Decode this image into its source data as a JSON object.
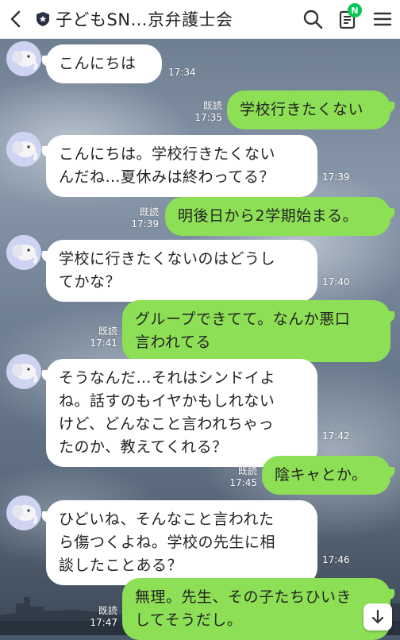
{
  "header": {
    "title": "子どもSN…京弁護士会",
    "notification_badge": "N",
    "icons": [
      "back-chevron-icon",
      "shield-star-icon",
      "search-icon",
      "notes-icon",
      "menu-icon"
    ]
  },
  "messages": [
    {
      "side": "left",
      "lines": [
        "こんにちは"
      ],
      "time": "17:34"
    },
    {
      "side": "right",
      "lines": [
        "学校行きたくない"
      ],
      "read": "既読",
      "time": "17:35"
    },
    {
      "side": "left",
      "lines": [
        "こんにちは。学校行きたくない",
        "んだね…夏休みは終わってる？"
      ],
      "time": "17:39"
    },
    {
      "side": "right",
      "lines": [
        "明後日から2学期始まる。"
      ],
      "read": "既読",
      "time": "17:39"
    },
    {
      "side": "left",
      "lines": [
        "学校に行きたくないのはどうし",
        "てかな？"
      ],
      "time": "17:40"
    },
    {
      "side": "right",
      "lines": [
        "グループできてて。なんか悪口",
        "言われてる"
      ],
      "read": "既読",
      "time": "17:41"
    },
    {
      "side": "left",
      "lines": [
        "そうなんだ…それはシンドイよ",
        "ね。話すのもイヤかもしれない",
        "けど、どんなこと言われちゃっ",
        "たのか、教えてくれる？"
      ],
      "time": "17:42"
    },
    {
      "side": "right",
      "lines": [
        "陰キャとか。"
      ],
      "read": "既読",
      "time": "17:45"
    },
    {
      "side": "left",
      "lines": [
        "ひどいね、そんなこと言われた",
        "ら傷つくよね。学校の先生に相",
        "談したことある？"
      ],
      "time": "17:46"
    },
    {
      "side": "right",
      "lines": [
        "無理。先生、その子たちひいき",
        "してそうだし。"
      ],
      "read": "既読",
      "time": "17:47"
    }
  ],
  "colors": {
    "right_bubble": "#8de055",
    "left_bubble": "#ffffff",
    "badge": "#06c755"
  }
}
